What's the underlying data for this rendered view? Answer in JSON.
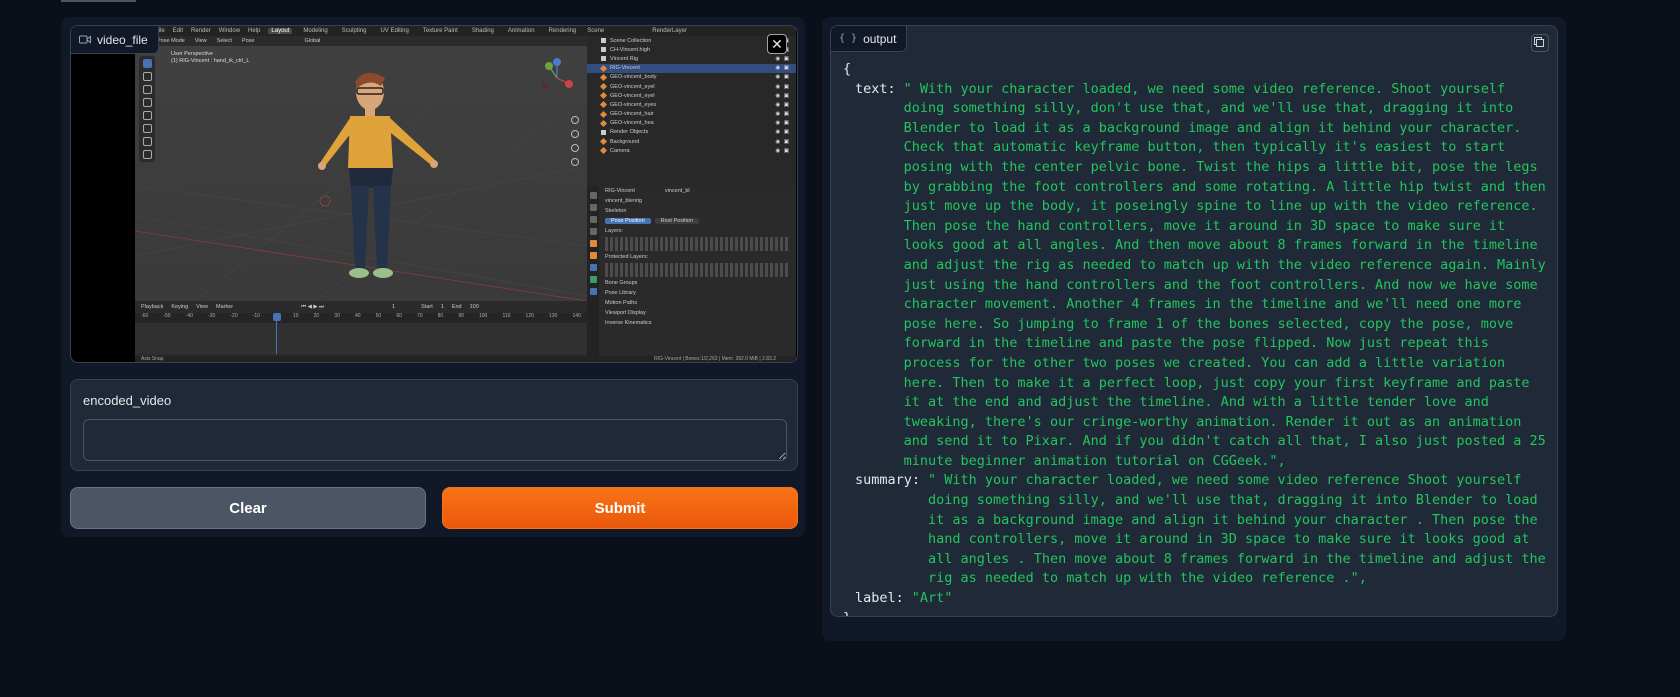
{
  "video": {
    "label": "video_file",
    "blender": {
      "menu": [
        "File",
        "Edit",
        "Render",
        "Window",
        "Help"
      ],
      "workspaces": [
        "Layout",
        "Modeling",
        "Sculpting",
        "UV Editing",
        "Texture Paint",
        "Shading",
        "Animation",
        "Rendering"
      ],
      "scene": "Scene",
      "view_layer": "RenderLayer",
      "mode": "Pose Mode",
      "header_menu": [
        "View",
        "Select",
        "Pose"
      ],
      "transform_orientation": "Global",
      "viewport_info_line1": "User Perspective",
      "viewport_info_line2": "(1) RIG-Vincent : hand_ik_ctrl_L",
      "outliner": [
        {
          "name": "Scene Collection",
          "type": "collection"
        },
        {
          "name": "CH-Vincent.high",
          "type": "collection"
        },
        {
          "name": "Vincent Rig",
          "type": "collection"
        },
        {
          "name": "RIG-Vincent",
          "type": "object",
          "selected": true
        },
        {
          "name": "GEO-vincent_body",
          "type": "object"
        },
        {
          "name": "GEO-vincent_eyel",
          "type": "object"
        },
        {
          "name": "GEO-vincent_eyel",
          "type": "object"
        },
        {
          "name": "GEO-vincent_eyes",
          "type": "object"
        },
        {
          "name": "GEO-vincent_hair",
          "type": "object"
        },
        {
          "name": "GEO-vincent_hea",
          "type": "object"
        },
        {
          "name": "Render Objects",
          "type": "collection"
        },
        {
          "name": "Background",
          "type": "object"
        },
        {
          "name": "Camera",
          "type": "object"
        }
      ],
      "props": {
        "object": "RIG-Vincent",
        "data": "vincent_bl",
        "armature": "vincent_blenrig",
        "skeleton": "Skeleton",
        "pose_position": "Pose Position",
        "rest_position": "Rest Position",
        "layers": "Layers:",
        "protected_layers": "Protected Layers:",
        "panels": [
          "Bone Groups",
          "Pose Library",
          "Motion Paths",
          "Viewport Display",
          "Inverse Kinematics"
        ]
      },
      "timeline": {
        "menu": [
          "Playback",
          "Keying",
          "View",
          "Marker"
        ],
        "current_frame": "1",
        "start_label": "Start",
        "start": "1",
        "end_label": "End",
        "end": "100",
        "ruler": [
          "-60",
          "-50",
          "-40",
          "-30",
          "-20",
          "-10",
          "0",
          "10",
          "20",
          "30",
          "40",
          "50",
          "60",
          "70",
          "80",
          "90",
          "100",
          "110",
          "120",
          "130",
          "140"
        ]
      },
      "status_left": "Axis Snap",
      "status_right": "RIG-Vincent | Bones:1/2,263 | Mem: 392.0 MiB | 2.83.2"
    }
  },
  "encoded_video": {
    "label": "encoded_video",
    "value": ""
  },
  "buttons": {
    "clear": "Clear",
    "submit": "Submit"
  },
  "output": {
    "label": "output",
    "open_brace": "{",
    "close_brace": "}",
    "text_key": "text:",
    "text_value": "\" With your character loaded, we need some video reference. Shoot yourself doing something silly, don't use that, and we'll use that, dragging it into Blender to load it as a background image and align it behind your character. Check that automatic keyframe button, then typically it's easiest to start posing with the center pelvic bone. Twist the hips a little bit, pose the legs by grabbing the foot controllers and some rotating. A little hip twist and then just move up the body, it poseingly spine to line up with the video reference. Then pose the hand controllers, move it around in 3D space to make sure it looks good at all angles. And then move about 8 frames forward in the timeline and adjust the rig as needed to match up with the video reference again. Mainly just using the hand controllers and the foot controllers. And now we have some character movement. Another 4 frames in the timeline and we'll need one more pose here. So jumping to frame 1 of the bones selected, copy the pose, move forward in the timeline and paste the pose flipped. Now just repeat this process for the other two poses we created. You can add a little variation here. Then to make it a perfect loop, just copy your first keyframe and paste it at the end and adjust the timeline. And with a little tender love and tweaking, there's our cringe-worthy animation. Render it out as an animation and send it to Pixar. And if you didn't catch all that, I also just posted a 25 minute beginner animation tutorial on CGGeek.\",",
    "summary_key": "summary:",
    "summary_value": "\" With your character loaded, we need some video reference Shoot yourself doing something silly, and we'll use that, dragging it into Blender to load it as a background image and align it behind your character . Then pose the hand controllers, move it around in 3D space to make sure it looks good at all angles . Then move about 8 frames forward in the timeline and adjust the rig as needed to match up with the video reference .\",",
    "label_key": "label:",
    "label_value": "\"Art\""
  },
  "colors": {
    "background": "#0b0f19",
    "panel": "#111827",
    "block": "#1f2937",
    "submit": "#ea580c",
    "clear": "#4b5563",
    "json_string": "#22c55e"
  }
}
